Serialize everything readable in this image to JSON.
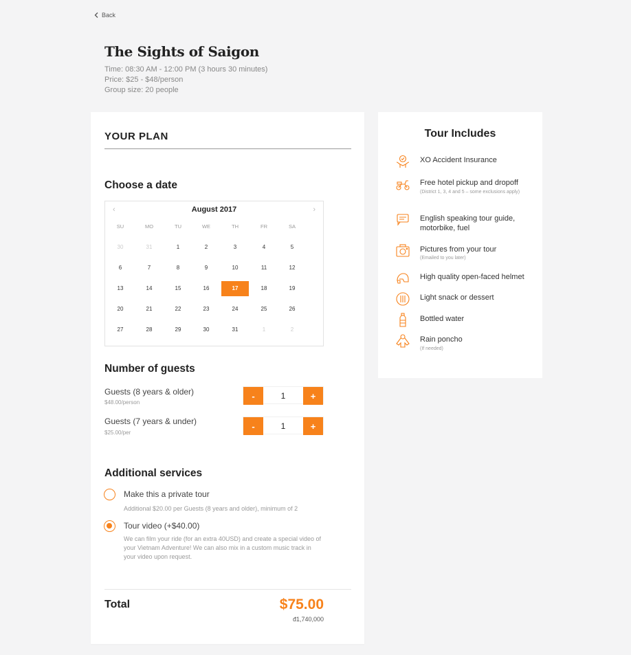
{
  "nav": {
    "back_label": "Back"
  },
  "tour": {
    "title": "The Sights of Saigon",
    "time": "Time: 08:30 AM - 12:00 PM (3 hours 30 minutes)",
    "price": "Price: $25 - $48/person",
    "group_size": "Group size: 20 people"
  },
  "plan": {
    "heading": "YOUR PLAN",
    "date_section_title": "Choose a date",
    "calendar": {
      "month": "August 2017",
      "prev": "‹",
      "next": "›",
      "weekdays": [
        "SU",
        "MO",
        "TU",
        "WE",
        "TH",
        "FR",
        "SA"
      ],
      "weeks": [
        [
          "30",
          "31",
          "1",
          "2",
          "3",
          "4",
          "5"
        ],
        [
          "6",
          "7",
          "8",
          "9",
          "10",
          "11",
          "12"
        ],
        [
          "13",
          "14",
          "15",
          "16",
          "17",
          "18",
          "19"
        ],
        [
          "20",
          "21",
          "22",
          "23",
          "24",
          "25",
          "26"
        ],
        [
          "27",
          "28",
          "29",
          "30",
          "31",
          "1",
          "2"
        ]
      ],
      "selected_day": "17"
    },
    "guests_section_title": "Number of guests",
    "guests": [
      {
        "label": "Guests (8 years & older)",
        "sub": "$48.00/person",
        "count": "1",
        "minus": "-",
        "plus": "+"
      },
      {
        "label": "Guests (7 years & under)",
        "sub": "$25.00/per",
        "count": "1",
        "minus": "-",
        "plus": "+"
      }
    ],
    "services_section_title": "Additional services",
    "services": [
      {
        "label": "Make this a private tour",
        "desc": "Additional $20.00 per Guests (8 years and older), minimum of 2",
        "checked": false
      },
      {
        "label": "Tour video (+$40.00)",
        "desc": "We can film your ride (for an extra 40USD) and create a special video of your Vietnam Adventure! We can also mix in a custom music track in your video upon request.",
        "checked": true
      }
    ],
    "total_label": "Total",
    "total_usd": "$75.00",
    "total_vnd": "đ1,740,000"
  },
  "includes": {
    "title": "Tour Includes",
    "items": [
      {
        "icon": "insurance-icon",
        "label": "XO Accident Insurance",
        "sub": ""
      },
      {
        "icon": "scooter-icon",
        "label": "Free hotel pickup and dropoff",
        "sub": "(District 1, 3, 4 and 5 – some exclusions apply)"
      },
      {
        "icon": "speech-icon",
        "label": "English speaking tour guide, motorbike, fuel",
        "sub": ""
      },
      {
        "icon": "camera-icon",
        "label": "Pictures from your tour",
        "sub": "(Emailed to you later)"
      },
      {
        "icon": "helmet-icon",
        "label": "High quality open-faced helmet",
        "sub": ""
      },
      {
        "icon": "snack-icon",
        "label": "Light snack or dessert",
        "sub": ""
      },
      {
        "icon": "bottle-icon",
        "label": "Bottled water",
        "sub": ""
      },
      {
        "icon": "poncho-icon",
        "label": "Rain poncho",
        "sub": "(If needed)"
      }
    ]
  },
  "colors": {
    "accent": "#f7821b",
    "background": "#f4f4f5",
    "card": "#ffffff"
  }
}
